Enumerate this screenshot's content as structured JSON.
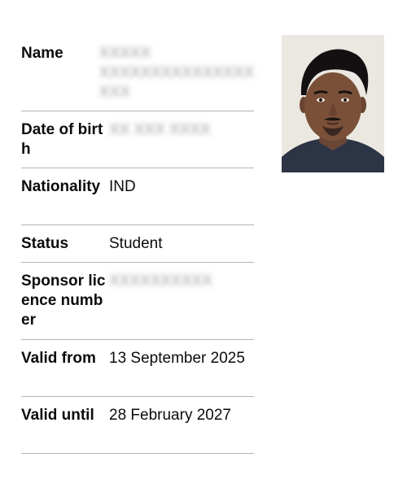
{
  "details": {
    "name": {
      "label": "Name",
      "value": "XXXXX XXXXXXXXXXXXXXX XXX"
    },
    "dob": {
      "label": "Date of birth",
      "value": "XX XXX XXXX"
    },
    "nationality": {
      "label": "Nationality",
      "value": "IND"
    },
    "status": {
      "label": "Status",
      "value": "Student"
    },
    "sponsor": {
      "label": "Sponsor licence number",
      "value": "XXXXXXXXXX"
    },
    "valid_from": {
      "label": "Valid from",
      "value": "13 September 2025"
    },
    "valid_until": {
      "label": "Valid until",
      "value": "28 February 2027"
    }
  }
}
